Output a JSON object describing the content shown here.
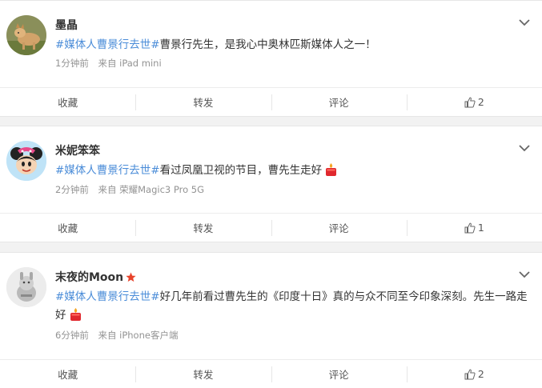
{
  "colors": {
    "hashtag": "#4a8cd8",
    "meta": "#939393",
    "background": "#f2f2f2",
    "vip_star": "#e8432b"
  },
  "posts": [
    {
      "username": "墨晶",
      "hashtag": "#媒体人曹景行去世#",
      "text": "曹景行先生，是我心中奥林匹斯媒体人之一！",
      "time": "1分钟前",
      "source": "来自 iPad mini",
      "actions": {
        "collect": "收藏",
        "repost": "转发",
        "comment": "评论",
        "likes": "2"
      },
      "avatar_icon": "dog-avatar-icon"
    },
    {
      "username": "米妮笨笨",
      "hashtag": "#媒体人曹景行去世#",
      "text": "看过凤凰卫视的节目，曹先生走好",
      "time": "2分钟前",
      "source": "来自 荣耀Magic3 Pro 5G",
      "actions": {
        "collect": "收藏",
        "repost": "转发",
        "comment": "评论",
        "likes": "1"
      },
      "avatar_icon": "minnie-avatar-icon"
    },
    {
      "username": "末夜的Moon",
      "hashtag": "#媒体人曹景行去世#",
      "text": "好几年前看过曹先生的《印度十日》真的与众不同至今印象深刻。先生一路走好",
      "time": "6分钟前",
      "source": "来自 iPhone客户端",
      "actions": {
        "collect": "收藏",
        "repost": "转发",
        "comment": "评论",
        "likes": "2"
      },
      "avatar_icon": "cartoon-avatar-icon"
    }
  ]
}
